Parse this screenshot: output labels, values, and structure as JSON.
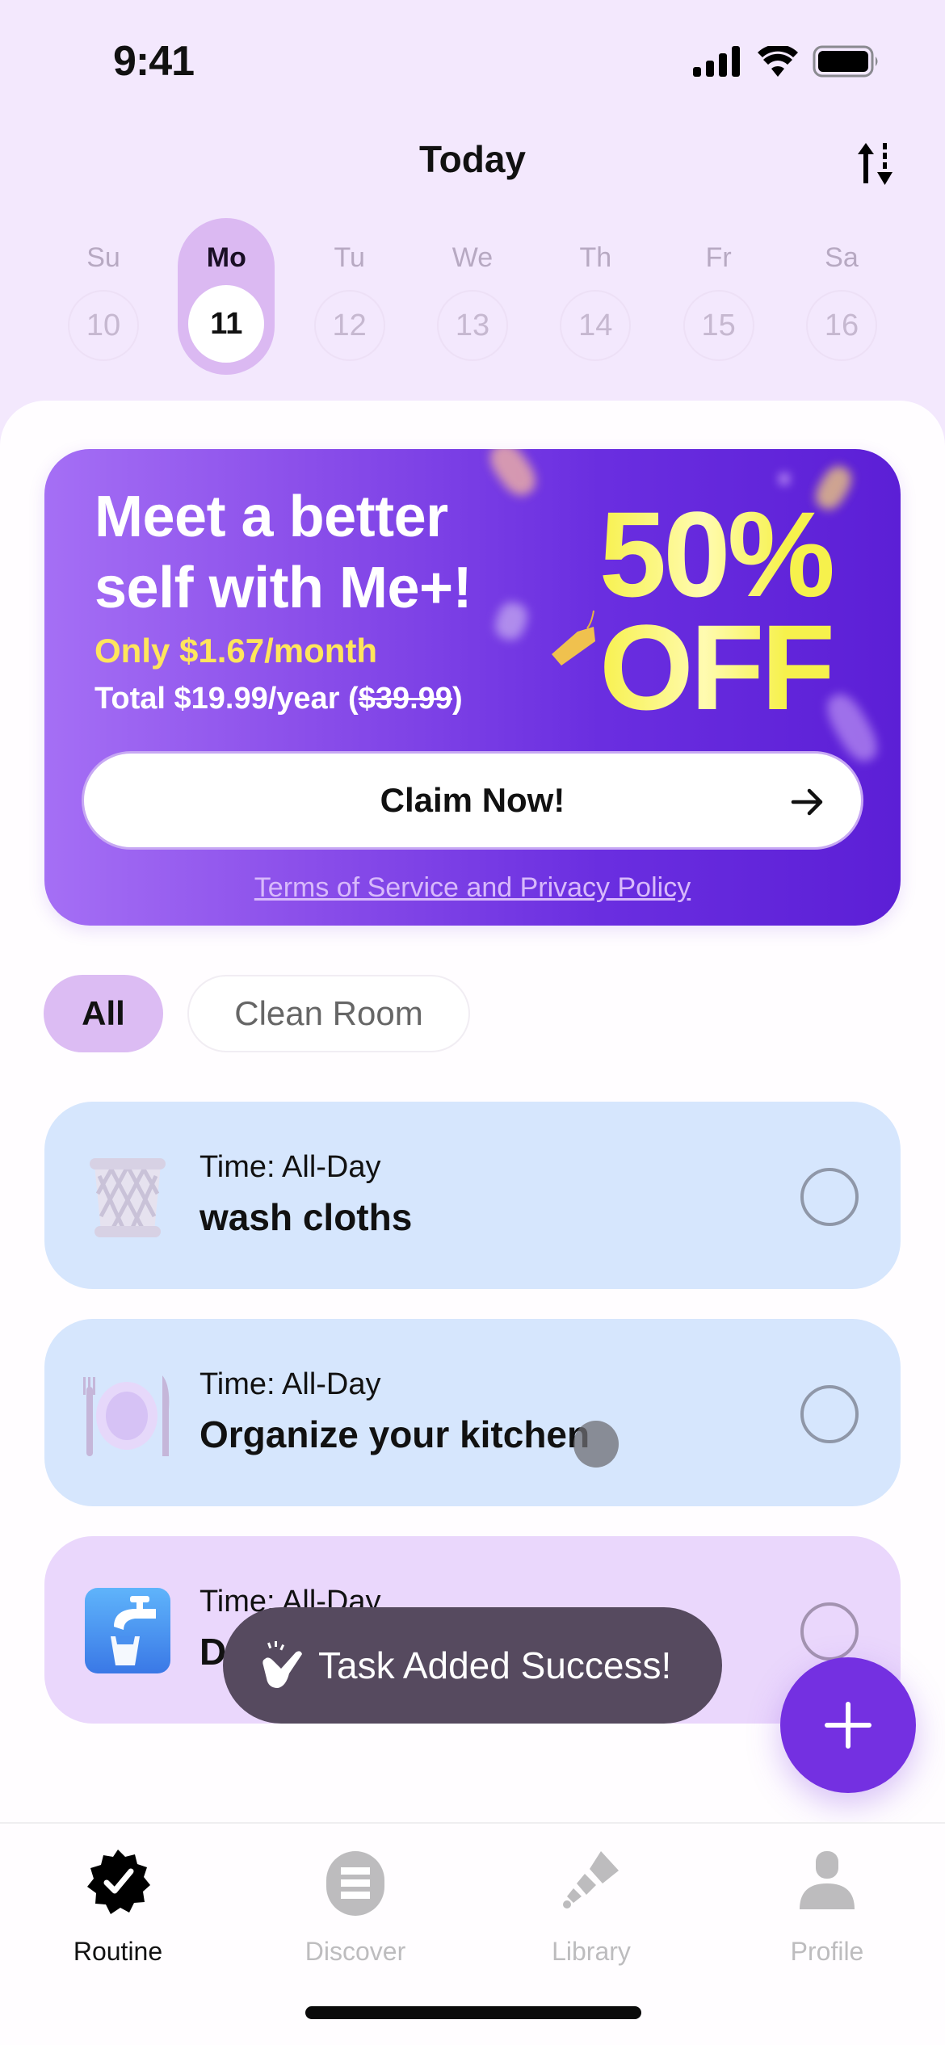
{
  "status_bar": {
    "time": "9:41"
  },
  "header": {
    "title": "Today",
    "sort_icon": "sort-arrows-icon"
  },
  "week": {
    "days": [
      {
        "name": "Su",
        "date": "10",
        "active": false
      },
      {
        "name": "Mo",
        "date": "11",
        "active": true
      },
      {
        "name": "Tu",
        "date": "12",
        "active": false
      },
      {
        "name": "We",
        "date": "13",
        "active": false
      },
      {
        "name": "Th",
        "date": "14",
        "active": false
      },
      {
        "name": "Fr",
        "date": "15",
        "active": false
      },
      {
        "name": "Sa",
        "date": "16",
        "active": false
      }
    ]
  },
  "promo": {
    "headline_line1": "Meet a better",
    "headline_line2": "self with Me+!",
    "monthly": "Only $1.67/month",
    "total_prefix": "Total $19.99/year (",
    "total_original": "$39.99",
    "total_suffix": ")",
    "discount_line1": "50%",
    "discount_line2": "OFF",
    "cta_label": "Claim Now!",
    "terms_link": "Terms of Service and Privacy Policy",
    "colors": {
      "gradient_start": "#a56ff5",
      "gradient_end": "#5c1fd6",
      "highlight": "#f9f564"
    }
  },
  "filters": [
    {
      "label": "All",
      "active": true
    },
    {
      "label": "Clean Room",
      "active": false
    }
  ],
  "tasks": [
    {
      "time": "Time: All-Day",
      "title": "wash cloths",
      "icon": "laundry-basket-icon",
      "color": "#d6e6fd",
      "done": false
    },
    {
      "time": "Time: All-Day",
      "title": "Organize your kitchen",
      "icon": "plate-cutlery-icon",
      "color": "#d6e6fd",
      "done": false
    },
    {
      "time": "Time: All-Day",
      "title": "D",
      "icon": "water-tap-icon",
      "color": "#ead7fc",
      "done": false
    }
  ],
  "toast": {
    "text": "Task Added Success!",
    "icon": "snap-fingers-icon"
  },
  "fab": {
    "icon": "plus-icon",
    "color": "#7430e1"
  },
  "tabbar": {
    "items": [
      {
        "label": "Routine",
        "icon": "verified-badge-icon",
        "active": true
      },
      {
        "label": "Discover",
        "icon": "discover-list-icon",
        "active": false
      },
      {
        "label": "Library",
        "icon": "telescope-icon",
        "active": false
      },
      {
        "label": "Profile",
        "icon": "person-icon",
        "active": false
      }
    ]
  }
}
